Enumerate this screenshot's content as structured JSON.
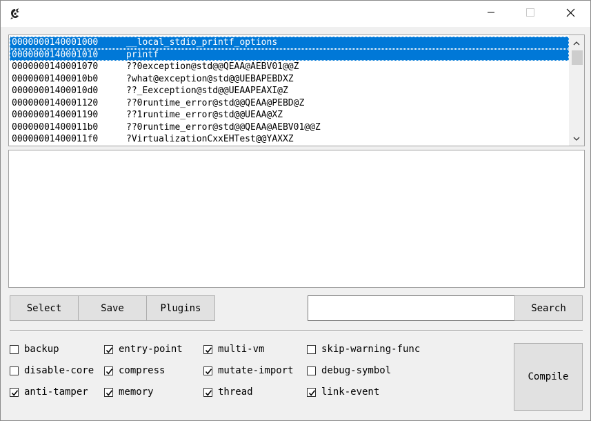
{
  "window": {
    "app_icon": "dragon-icon",
    "controls": [
      "minimize-icon",
      "maximize-icon",
      "close-icon"
    ]
  },
  "symbols": [
    {
      "address": "0000000140001000",
      "name": "__local_stdio_printf_options",
      "selected": true
    },
    {
      "address": "0000000140001010",
      "name": "printf",
      "selected": true
    },
    {
      "address": "0000000140001070",
      "name": "??0exception@std@@QEAA@AEBV01@@Z",
      "selected": false
    },
    {
      "address": "00000001400010b0",
      "name": "?what@exception@std@@UEBAPEBDXZ",
      "selected": false
    },
    {
      "address": "00000001400010d0",
      "name": "??_Eexception@std@@UEAAPEAXI@Z",
      "selected": false
    },
    {
      "address": "0000000140001120",
      "name": "??0runtime_error@std@@QEAA@PEBD@Z",
      "selected": false
    },
    {
      "address": "0000000140001190",
      "name": "??1runtime_error@std@@UEAA@XZ",
      "selected": false
    },
    {
      "address": "00000001400011b0",
      "name": "??0runtime_error@std@@QEAA@AEBV01@@Z",
      "selected": false
    },
    {
      "address": "00000001400011f0",
      "name": "?VirtualizationCxxEHTest@@YAXXZ",
      "selected": false
    }
  ],
  "output_text": "",
  "toolbar": {
    "select_label": "Select",
    "save_label": "Save",
    "plugins_label": "Plugins",
    "search_value": "",
    "search_label": "Search"
  },
  "options": [
    {
      "id": "backup",
      "label": "backup",
      "checked": false
    },
    {
      "id": "disable-core",
      "label": "disable-core",
      "checked": false
    },
    {
      "id": "anti-tamper",
      "label": "anti-tamper",
      "checked": true
    },
    {
      "id": "entry-point",
      "label": "entry-point",
      "checked": true
    },
    {
      "id": "compress",
      "label": "compress",
      "checked": true
    },
    {
      "id": "memory",
      "label": "memory",
      "checked": true
    },
    {
      "id": "multi-vm",
      "label": "multi-vm",
      "checked": true
    },
    {
      "id": "mutate-import",
      "label": "mutate-import",
      "checked": true
    },
    {
      "id": "thread",
      "label": "thread",
      "checked": true
    },
    {
      "id": "skip-warning-func",
      "label": "skip-warning-func",
      "checked": false
    },
    {
      "id": "debug-symbol",
      "label": "debug-symbol",
      "checked": false
    },
    {
      "id": "link-event",
      "label": "link-event",
      "checked": true
    }
  ],
  "compile_label": "Compile",
  "colors": {
    "selection": "#0078d7",
    "button_face": "#e1e1e1",
    "window_bg": "#f0f0f0"
  }
}
